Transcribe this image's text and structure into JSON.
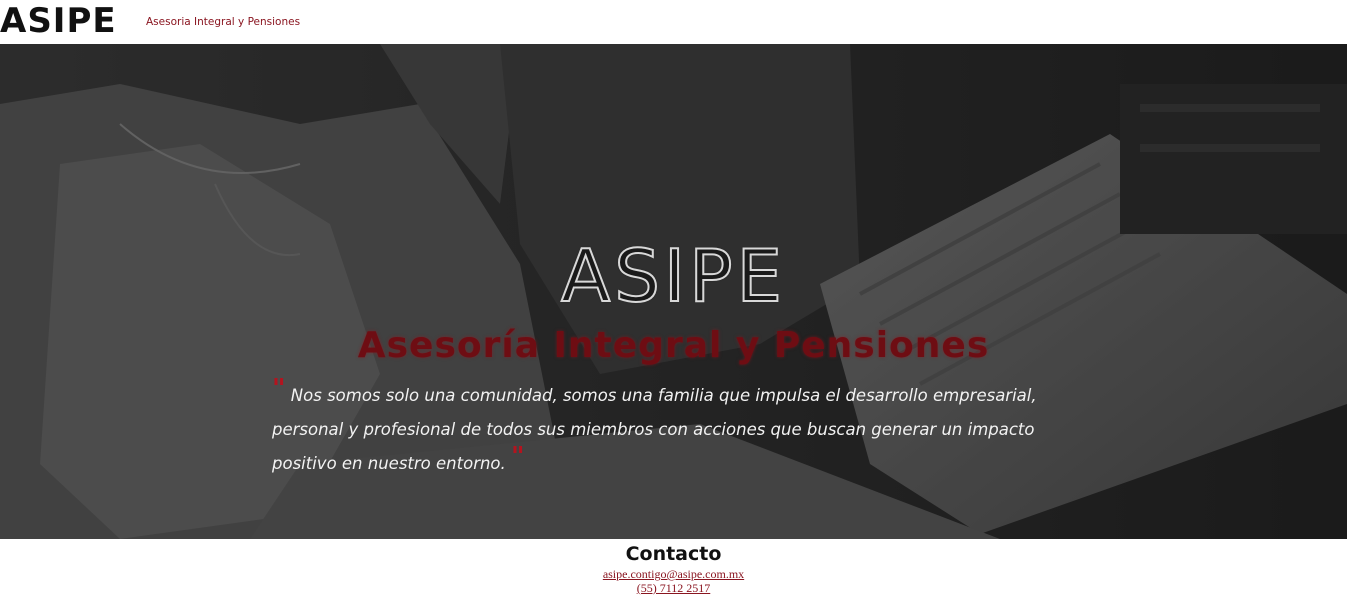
{
  "header": {
    "logo": "ASIPE",
    "tagline": "Asesoria Integral y Pensiones"
  },
  "hero": {
    "title": "ASIPE",
    "subtitle": "Asesoría Integral y Pensiones",
    "quote_open": "\"",
    "quote": "Nos somos solo una comunidad, somos una familia que impulsa el desarrollo empresarial, personal y profesional de todos sus miembros con acciones que buscan generar un impacto positivo en nuestro entorno.",
    "quote_close": "\"",
    "photo": "office-meeting-photo"
  },
  "contact": {
    "title": "Contacto",
    "email": "asipe.contigo@asipe.com.mx",
    "phone": "(55) 7112 2517"
  },
  "colors": {
    "brand_dark": "#111111",
    "brand_red": "#8a1520",
    "hero_subtitle": "#6e0d13"
  }
}
